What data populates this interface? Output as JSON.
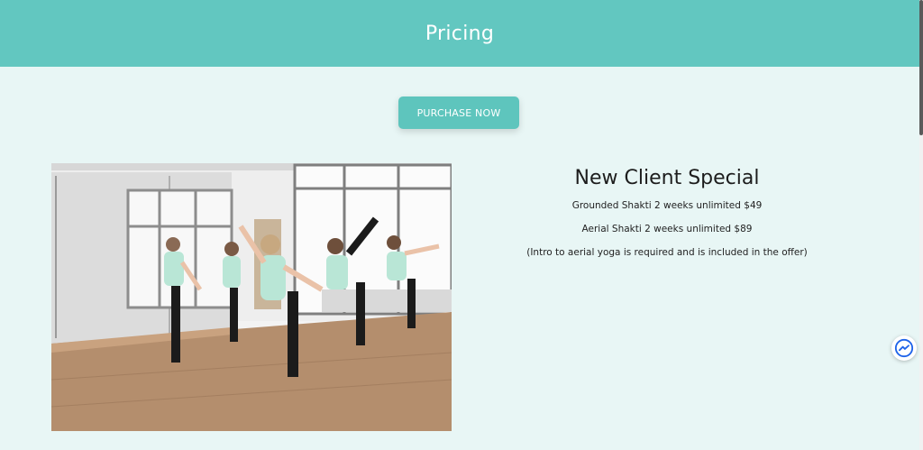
{
  "header": {
    "title": "Pricing"
  },
  "cta": {
    "label": "PURCHASE NOW"
  },
  "offer": {
    "title": "New Client Special",
    "lines": [
      "Grounded Shakti 2 weeks unlimited $49",
      "Aerial Shakti 2 weeks unlimited $89",
      "(Intro to aerial yoga is required and is included in the offer)"
    ]
  },
  "photo": {
    "alt": "Yoga class in studio doing standing bow pose"
  },
  "colors": {
    "header": "#62c7c0",
    "page_bg": "#e8f6f5",
    "button": "#5ec5bd",
    "messenger": "#1e63e9"
  },
  "icons": {
    "chat": "messenger-icon"
  }
}
